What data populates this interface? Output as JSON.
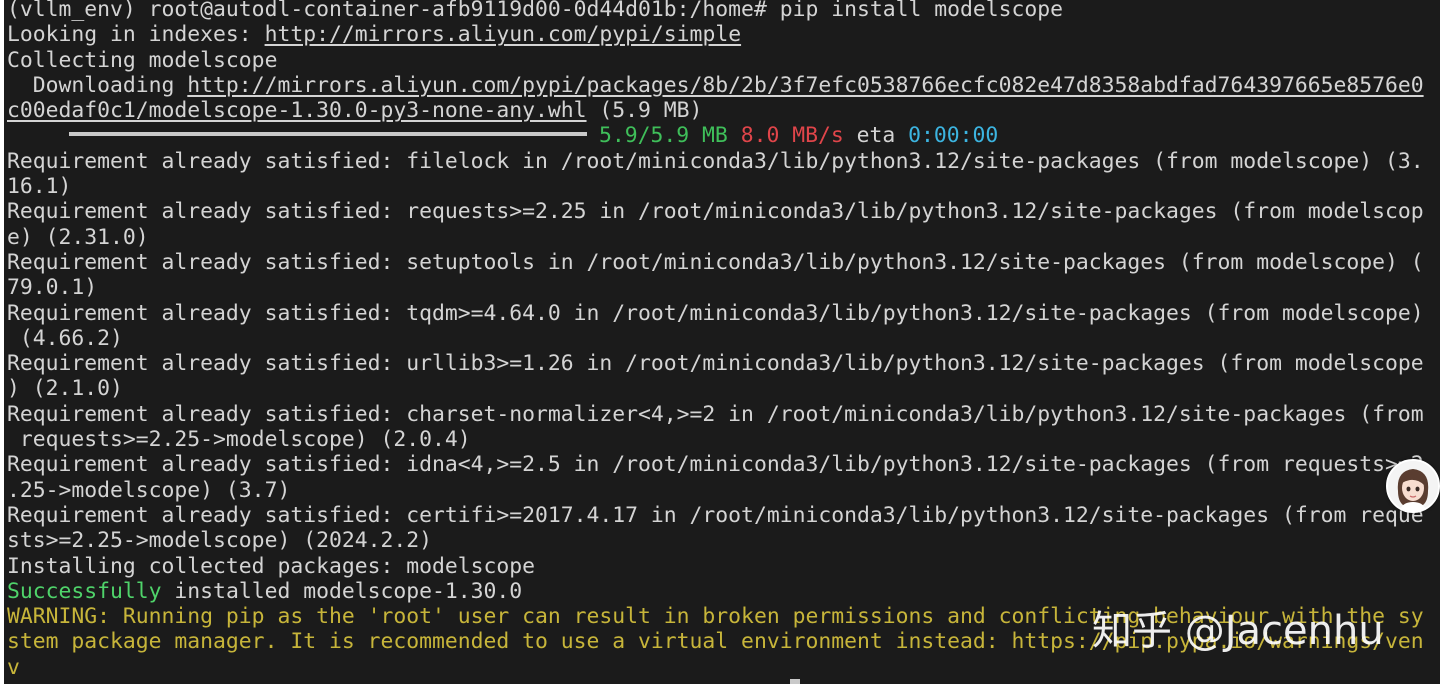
{
  "terminal": {
    "lines": [
      {
        "segments": [
          {
            "text": "(vllm_env) root@autodl-container-afb9119d00-0d44d01b:/home# pip install modelscope"
          }
        ]
      },
      {
        "segments": [
          {
            "text": "Looking in indexes: "
          },
          {
            "text": "http://mirrors.aliyun.com/pypi/simple",
            "style": "url"
          }
        ]
      },
      {
        "segments": [
          {
            "text": "Collecting modelscope"
          }
        ]
      },
      {
        "segments": [
          {
            "text": "  Downloading "
          },
          {
            "text": "http://mirrors.aliyun.com/pypi/packages/8b/2b/3f7efc0538766ecfc082e47d8358abdfad764397665e8576e0",
            "style": "url"
          }
        ]
      },
      {
        "segments": [
          {
            "text": "c00edaf0c1/modelscope-1.30.0-py3-none-any.whl",
            "style": "url"
          },
          {
            "text": " (5.9 MB)"
          }
        ]
      },
      {
        "segments": [
          {
            "text": "5.9/5.9 MB",
            "style": "green"
          },
          {
            "text": " "
          },
          {
            "text": "8.0 MB/s",
            "style": "red"
          },
          {
            "text": " eta "
          },
          {
            "text": "0:00:00",
            "style": "cyan"
          }
        ],
        "progress": 1.0
      },
      {
        "segments": [
          {
            "text": "Requirement already satisfied: filelock in /root/miniconda3/lib/python3.12/site-packages (from modelscope) (3."
          }
        ]
      },
      {
        "segments": [
          {
            "text": "16.1)"
          }
        ]
      },
      {
        "segments": [
          {
            "text": "Requirement already satisfied: requests>=2.25 in /root/miniconda3/lib/python3.12/site-packages (from modelscop"
          }
        ]
      },
      {
        "segments": [
          {
            "text": "e) (2.31.0)"
          }
        ]
      },
      {
        "segments": [
          {
            "text": "Requirement already satisfied: setuptools in /root/miniconda3/lib/python3.12/site-packages (from modelscope) ("
          }
        ]
      },
      {
        "segments": [
          {
            "text": "79.0.1)"
          }
        ]
      },
      {
        "segments": [
          {
            "text": "Requirement already satisfied: tqdm>=4.64.0 in /root/miniconda3/lib/python3.12/site-packages (from modelscope)"
          }
        ]
      },
      {
        "segments": [
          {
            "text": " (4.66.2)"
          }
        ]
      },
      {
        "segments": [
          {
            "text": "Requirement already satisfied: urllib3>=1.26 in /root/miniconda3/lib/python3.12/site-packages (from modelscope"
          }
        ]
      },
      {
        "segments": [
          {
            "text": ") (2.1.0)"
          }
        ]
      },
      {
        "segments": [
          {
            "text": "Requirement already satisfied: charset-normalizer<4,>=2 in /root/miniconda3/lib/python3.12/site-packages (from"
          }
        ]
      },
      {
        "segments": [
          {
            "text": " requests>=2.25->modelscope) (2.0.4)"
          }
        ]
      },
      {
        "segments": [
          {
            "text": "Requirement already satisfied: idna<4,>=2.5 in /root/miniconda3/lib/python3.12/site-packages (from requests>=2"
          }
        ]
      },
      {
        "segments": [
          {
            "text": ".25->modelscope) (3.7)"
          }
        ]
      },
      {
        "segments": [
          {
            "text": "Requirement already satisfied: certifi>=2017.4.17 in /root/miniconda3/lib/python3.12/site-packages (from reque"
          }
        ]
      },
      {
        "segments": [
          {
            "text": "sts>=2.25->modelscope) (2024.2.2)"
          }
        ]
      },
      {
        "segments": [
          {
            "text": "Installing collected packages: modelscope"
          }
        ]
      },
      {
        "segments": [
          {
            "text": "Successfully",
            "style": "bright-green"
          },
          {
            "text": " installed modelscope-1.30.0"
          }
        ]
      },
      {
        "segments": [
          {
            "text": "WARNING: Running pip as the 'root' user can result in broken permissions and conflicting behaviour with the sy",
            "style": "yellow"
          }
        ]
      },
      {
        "segments": [
          {
            "text": "stem package manager. It is recommended to use a virtual environment instead: https://pip.pypa.io/warnings/ven",
            "style": "yellow"
          }
        ]
      },
      {
        "segments": [
          {
            "text": "v",
            "style": "yellow"
          }
        ]
      }
    ]
  },
  "watermark": {
    "text": "知乎 @Jacenhu"
  },
  "colors": {
    "background": "#1b1b1b",
    "text": "#d4d4d4",
    "progress_green": "#3fbf5a",
    "speed_red": "#e0454a",
    "eta_cyan": "#3cb4e0",
    "warning_yellow": "#c7b53a"
  },
  "avatar": {
    "icon": "avatar-icon"
  }
}
